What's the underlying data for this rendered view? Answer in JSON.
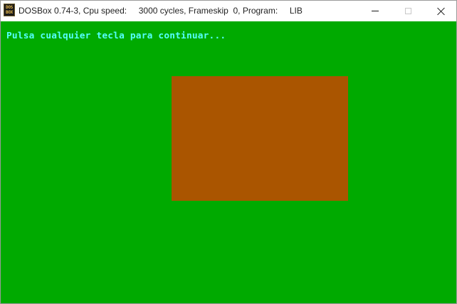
{
  "window": {
    "icon_text_top": "DOS",
    "icon_text_bottom": "BOX",
    "title": "DOSBox 0.74-3, Cpu speed:     3000 cycles, Frameskip  0, Program:     LIB"
  },
  "screen": {
    "prompt": "Pulsa cualquier tecla para continuar...",
    "background_color": "#00aa00",
    "text_color": "#55ffff",
    "shape_color": "#aa5500"
  }
}
